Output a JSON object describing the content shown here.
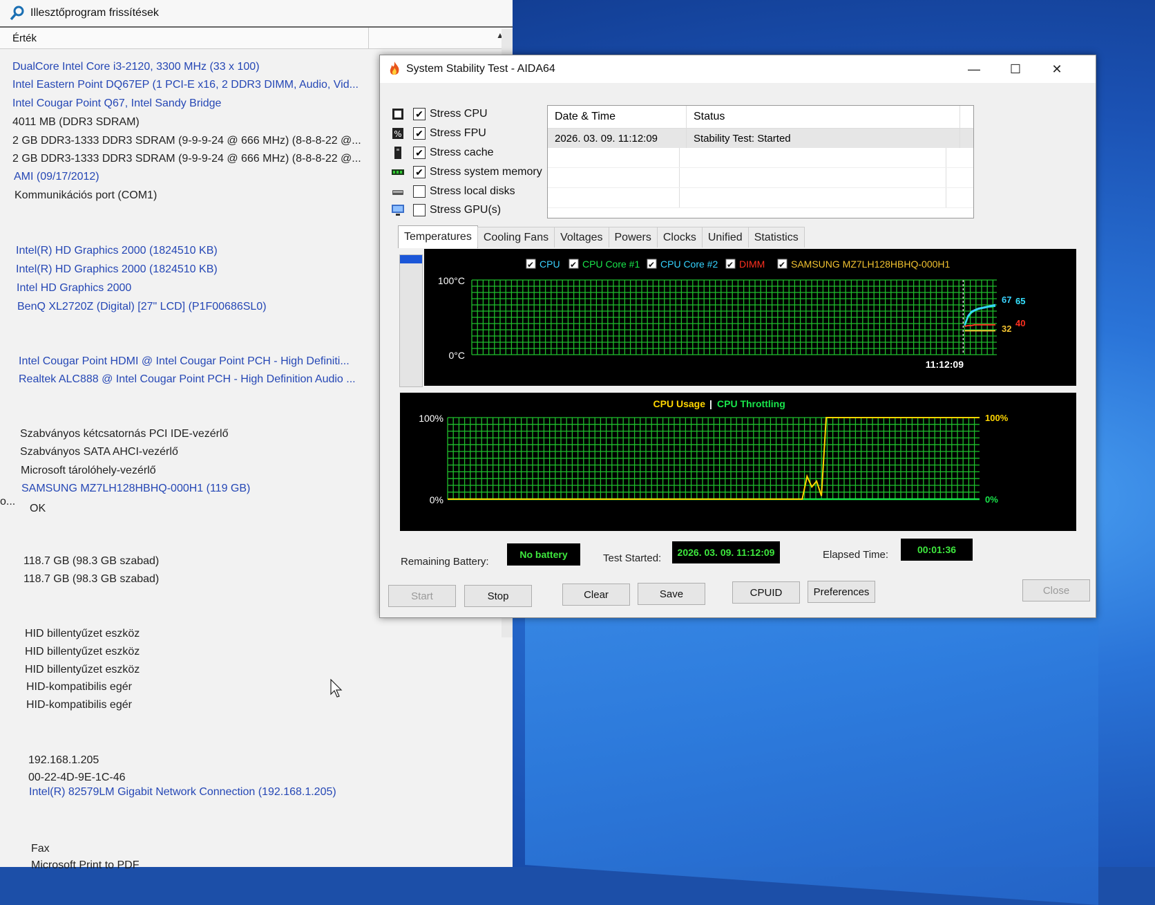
{
  "main_window": {
    "title": "Illesztőprogram frissítések",
    "column_header": "Érték",
    "rows": [
      {
        "text": "DualCore Intel Core i3-2120, 3300 MHz (33 x 100)",
        "link": true
      },
      {
        "text": "Intel Eastern Point DQ67EP  (1 PCI-E x16, 2 DDR3 DIMM, Audio, Vid...",
        "link": true
      },
      {
        "text": "Intel Cougar Point Q67, Intel Sandy Bridge",
        "link": true
      },
      {
        "text": "4011 MB  (DDR3 SDRAM)",
        "link": false
      },
      {
        "text": "2 GB DDR3-1333 DDR3 SDRAM  (9-9-9-24 @ 666 MHz)  (8-8-8-22 @...",
        "link": false
      },
      {
        "text": "2 GB DDR3-1333 DDR3 SDRAM  (9-9-9-24 @ 666 MHz)  (8-8-8-22 @...",
        "link": false
      },
      {
        "text": "AMI (09/17/2012)",
        "link": true
      },
      {
        "text": "Kommunikációs port (COM1)",
        "link": false
      },
      {
        "text": "Intel(R) HD Graphics 2000  (1824510 KB)",
        "link": true
      },
      {
        "text": "Intel(R) HD Graphics 2000  (1824510 KB)",
        "link": true
      },
      {
        "text": "Intel HD Graphics 2000",
        "link": true
      },
      {
        "text": "BenQ XL2720Z (Digital)  [27\" LCD]  (P1F00686SL0)",
        "link": true
      },
      {
        "text": "Intel Cougar Point HDMI @ Intel Cougar Point PCH - High Definiti...",
        "link": true
      },
      {
        "text": "Realtek ALC888 @ Intel Cougar Point PCH - High Definition Audio ...",
        "link": true
      },
      {
        "text": "Szabványos kétcsatornás PCI IDE-vezérlő",
        "link": false
      },
      {
        "text": "Szabványos SATA AHCI-vezérlő",
        "link": false
      },
      {
        "text": "Microsoft tárolóhely-vezérlő",
        "link": false
      },
      {
        "text": "SAMSUNG MZ7LH128HBHQ-000H1  (119 GB)",
        "link": true
      },
      {
        "text": "OK",
        "link": false
      },
      {
        "text": "118.7 GB (98.3 GB szabad)",
        "link": false
      },
      {
        "text": "118.7 GB (98.3 GB szabad)",
        "link": false
      },
      {
        "text": "HID billentyűzet eszköz",
        "link": false
      },
      {
        "text": "HID billentyűzet eszköz",
        "link": false
      },
      {
        "text": "HID billentyűzet eszköz",
        "link": false
      },
      {
        "text": "HID-kompatibilis egér",
        "link": false
      },
      {
        "text": "HID-kompatibilis egér",
        "link": false
      },
      {
        "text": "192.168.1.205",
        "link": false
      },
      {
        "text": "00-22-4D-9E-1C-46",
        "link": false
      },
      {
        "text": "Intel(R) 82579LM Gigabit Network Connection  (192.168.1.205)",
        "link": true
      },
      {
        "text": "Fax",
        "link": false
      },
      {
        "text": "Microsoft Print to PDF",
        "link": false
      }
    ],
    "truncated_prefix": "o..."
  },
  "stability_window": {
    "title": "System Stability Test - AIDA64",
    "window_controls": {
      "minimize": "—",
      "maximize": "☐",
      "close": "✕"
    },
    "options": [
      {
        "label": "Stress CPU",
        "checked": true,
        "icon": "cpu-icon"
      },
      {
        "label": "Stress FPU",
        "checked": true,
        "icon": "fpu-icon"
      },
      {
        "label": "Stress cache",
        "checked": true,
        "icon": "cache-icon"
      },
      {
        "label": "Stress system memory",
        "checked": true,
        "icon": "memory-icon"
      },
      {
        "label": "Stress local disks",
        "checked": false,
        "icon": "disk-icon"
      },
      {
        "label": "Stress GPU(s)",
        "checked": false,
        "icon": "gpu-icon"
      }
    ],
    "status_table": {
      "headers": [
        "Date & Time",
        "Status"
      ],
      "rows": [
        [
          "2026. 03. 09. 11:12:09",
          "Stability Test: Started"
        ]
      ]
    },
    "tabs": [
      "Temperatures",
      "Cooling Fans",
      "Voltages",
      "Powers",
      "Clocks",
      "Unified",
      "Statistics"
    ],
    "active_tab": "Temperatures",
    "remaining_battery_label": "Remaining Battery:",
    "remaining_battery_value": "No battery",
    "test_started_label": "Test Started:",
    "test_started_value": "2026. 03. 09. 11:12:09",
    "elapsed_label": "Elapsed Time:",
    "elapsed_value": "00:01:36",
    "buttons": {
      "start": "Start",
      "stop": "Stop",
      "clear": "Clear",
      "save": "Save",
      "cpuid": "CPUID",
      "preferences": "Preferences",
      "close": "Close"
    },
    "colors": {
      "grid": "#1fbf2c",
      "cpu": "#3ad2ff",
      "core1": "#19e64b",
      "core2": "#35d3ff",
      "dimm": "#ff3020",
      "ssd": "#f2c230",
      "usage": "#ffd600",
      "throttle": "#19e64b"
    }
  },
  "chart_data": [
    {
      "type": "line",
      "chart": "temperatures",
      "ylim": [
        0,
        100
      ],
      "y_tick_labels": [
        "100°C",
        "0°C"
      ],
      "x_marker_label": "11:12:09",
      "legend": [
        {
          "name": "CPU",
          "checked": true,
          "color": "#3ad2ff"
        },
        {
          "name": "CPU Core #1",
          "checked": true,
          "color": "#19e64b"
        },
        {
          "name": "CPU Core #2",
          "checked": true,
          "color": "#35d3ff"
        },
        {
          "name": "DIMM",
          "checked": true,
          "color": "#ff3020"
        },
        {
          "name": "SAMSUNG MZ7LH128HBHQ-000H1",
          "checked": true,
          "color": "#f2c230"
        }
      ],
      "end_labels": [
        {
          "value": "67",
          "color": "#3ad2ff"
        },
        {
          "value": "65",
          "color": "#19e64b"
        },
        {
          "value": "65",
          "color": "#35d3ff"
        },
        {
          "value": "40",
          "color": "#ff3020"
        },
        {
          "value": "32",
          "color": "#f2c230"
        }
      ],
      "series": [
        {
          "name": "CPU",
          "values": [
            40,
            52,
            58,
            60,
            62,
            63,
            64,
            65,
            66,
            67
          ]
        },
        {
          "name": "CPU Core #1",
          "values": [
            38,
            50,
            56,
            59,
            61,
            62,
            63,
            64,
            64,
            65
          ]
        },
        {
          "name": "CPU Core #2",
          "values": [
            39,
            51,
            57,
            59,
            61,
            62,
            63,
            64,
            65,
            65
          ]
        },
        {
          "name": "DIMM",
          "values": [
            38,
            39,
            39,
            40,
            40,
            40,
            40,
            40,
            40,
            40
          ]
        },
        {
          "name": "SAMSUNG MZ7LH128HBHQ-000H1",
          "values": [
            32,
            32,
            32,
            32,
            32,
            32,
            32,
            32,
            32,
            32
          ]
        }
      ]
    },
    {
      "type": "line",
      "chart": "usage",
      "title_parts": [
        {
          "text": "CPU Usage",
          "color": "#ffd600"
        },
        {
          "text": "|",
          "color": "#ffffff"
        },
        {
          "text": "CPU Throttling",
          "color": "#19e64b"
        }
      ],
      "ylim": [
        0,
        100
      ],
      "y_tick_labels": [
        "100%",
        "0%"
      ],
      "right_labels": [
        {
          "value": "100%",
          "color": "#ffd600"
        },
        {
          "value": "0%",
          "color": "#19e64b"
        }
      ],
      "series": [
        {
          "name": "CPU Usage",
          "values": [
            0,
            0,
            0,
            0,
            0,
            0,
            0,
            0,
            0,
            0,
            0,
            0,
            0,
            0,
            0,
            0,
            0,
            0,
            0,
            0,
            0,
            0,
            0,
            0,
            0,
            0,
            0,
            0,
            0,
            0,
            0,
            0,
            0,
            0,
            0,
            0,
            0,
            0,
            0,
            0,
            0,
            0,
            0,
            0,
            0,
            0,
            0,
            0,
            0,
            0,
            0,
            0,
            0,
            0,
            0,
            0,
            0,
            0,
            0,
            0,
            0,
            0,
            0,
            0,
            0,
            0,
            0,
            0,
            0,
            0,
            0,
            0,
            0,
            0,
            0,
            28,
            15,
            22,
            4,
            100,
            100,
            100,
            100,
            100,
            100,
            100,
            100,
            100,
            100,
            100,
            100,
            100,
            100,
            100,
            100,
            100,
            100,
            100,
            100,
            100,
            100,
            100,
            100,
            100,
            100,
            100,
            100,
            100,
            100,
            100,
            100,
            100
          ]
        },
        {
          "name": "CPU Throttling",
          "values": [
            0,
            0
          ]
        }
      ]
    }
  ]
}
